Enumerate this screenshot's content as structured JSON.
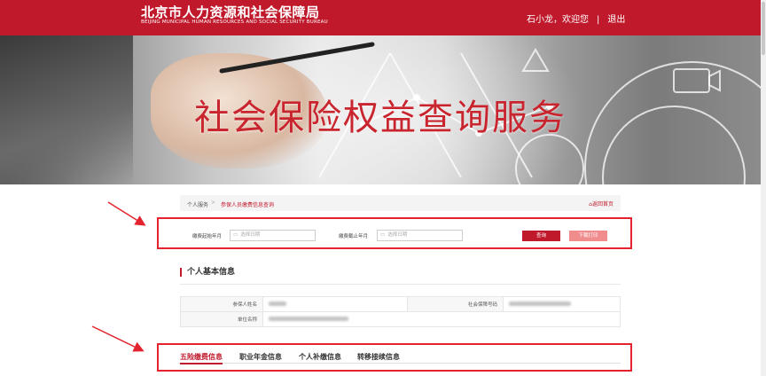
{
  "header": {
    "title_cn": "北京市人力资源和社会保障局",
    "title_en": "BEIJING MUNICIPAL HUMAN RESOURCES AND SOCIAL SECURITY BUREAU",
    "welcome": "石小龙，欢迎您",
    "separator": "|",
    "logout": "退出",
    "bg_color": "#c0192b"
  },
  "banner": {
    "title": "社会保险权益查询服务"
  },
  "breadcrumb": {
    "home": "个人服务",
    "arrow": ">",
    "current": "参保人员缴费信息查询",
    "back": "返回首页"
  },
  "query": {
    "start_label": "缴费起始年月",
    "start_placeholder": "选择日期",
    "end_label": "缴费截止年月",
    "end_placeholder": "选择日期",
    "query_button": "查询",
    "print_button": "下载打印"
  },
  "basic_info": {
    "title": "个人基本信息",
    "name_label": "参保人姓名",
    "ssn_label": "社会保障号码",
    "unit_label": "单位名称"
  },
  "tabs": [
    {
      "label": "五险缴费信息",
      "active": true
    },
    {
      "label": "职业年金信息",
      "active": false
    },
    {
      "label": "个人补缴信息",
      "active": false
    },
    {
      "label": "转移接续信息",
      "active": false
    }
  ],
  "colors": {
    "accent": "#c0192b",
    "highlight_border": "#e3232e",
    "print_button": "#f08c8c"
  }
}
